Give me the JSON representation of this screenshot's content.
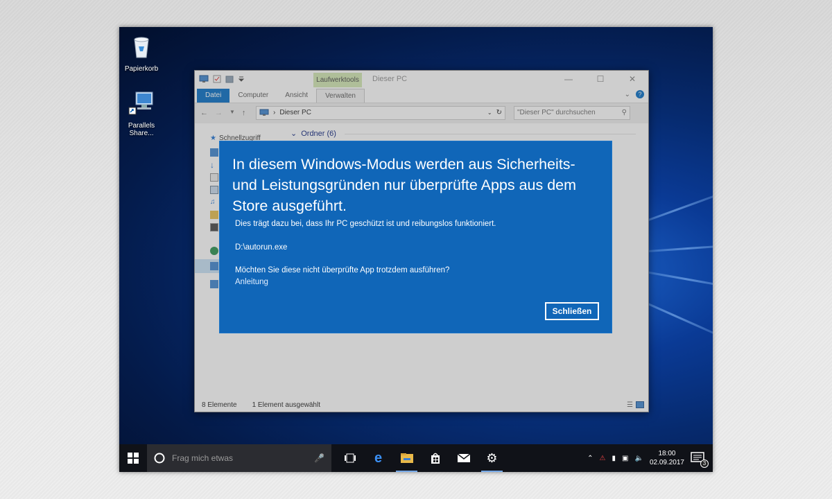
{
  "desktop": {
    "icons": [
      {
        "label": "Papierkorb"
      },
      {
        "label": "Parallels Share..."
      }
    ]
  },
  "explorer": {
    "title": "Dieser PC",
    "context_tab_group": "Laufwerktools",
    "tabs": [
      {
        "label": "Datei"
      },
      {
        "label": "Computer"
      },
      {
        "label": "Ansicht"
      },
      {
        "label": "Verwalten"
      }
    ],
    "address": "Dieser PC",
    "search_placeholder": "\"Dieser PC\" durchsuchen",
    "nav_quick_access": "Schnellzugriff",
    "section_header": "Ordner (6)",
    "status_items": "8 Elemente",
    "status_selected": "1 Element ausgewählt"
  },
  "dialog": {
    "title": "In diesem Windows-Modus werden aus Sicherheits- und Leistungsgründen nur überprüfte Apps aus dem Store ausgeführt.",
    "subtitle": "Dies trägt dazu bei, dass Ihr PC geschützt ist und reibungslos funktioniert.",
    "path": "D:\\autorun.exe",
    "question": "Möchten Sie diese nicht überprüfte App trotzdem ausführen?",
    "link": "Anleitung",
    "close_button": "Schließen",
    "accent_color": "#1066b8"
  },
  "taskbar": {
    "search_placeholder": "Frag mich etwas",
    "apps": [
      {
        "icon": "task-view-icon"
      },
      {
        "icon": "edge-icon"
      },
      {
        "icon": "file-explorer-icon"
      },
      {
        "icon": "store-icon"
      },
      {
        "icon": "mail-icon"
      },
      {
        "icon": "settings-icon"
      }
    ],
    "time": "18:00",
    "date": "02.09.2017",
    "notification_count": "3"
  }
}
